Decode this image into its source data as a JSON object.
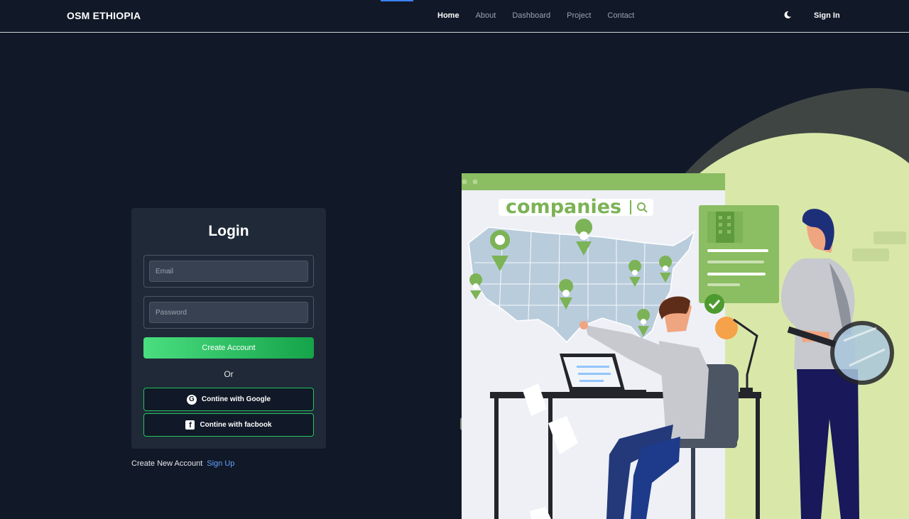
{
  "navbar": {
    "brand": "OSM ETHIOPIA",
    "links": [
      {
        "label": "Home",
        "active": true
      },
      {
        "label": "About",
        "active": false
      },
      {
        "label": "Dashboard",
        "active": false
      },
      {
        "label": "Project",
        "active": false
      },
      {
        "label": "Contact",
        "active": false
      }
    ],
    "theme_icon": "moon-icon",
    "signin_label": "Sign In"
  },
  "login": {
    "title": "Login",
    "email_placeholder": "Email",
    "password_placeholder": "Password",
    "create_label": "Create Account",
    "or_label": "Or",
    "google_label": "Contine with Google",
    "facebook_label": "Contine with facbook",
    "google_icon": "google-icon",
    "facebook_icon": "facebook-icon"
  },
  "signup": {
    "text": "Create New Account",
    "link": "Sign Up"
  },
  "illustration": {
    "search_text": "companies"
  },
  "colors": {
    "background": "#111827",
    "card": "#1f2937",
    "accent_green": "#22c55e",
    "link_blue": "#60a5fa",
    "illustration_green": "#d9e8a8"
  }
}
